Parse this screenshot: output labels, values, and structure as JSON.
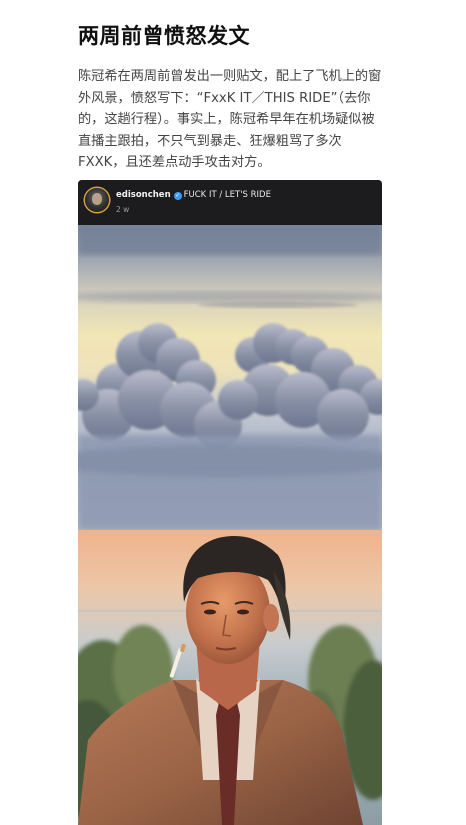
{
  "article": {
    "headline": "两周前曾愤怒发文",
    "body": "陈冠希在两周前曾发出一则贴文，配上了飞机上的窗外风景，愤怒写下：“FxxK IT／THIS RIDE”（去你的，这趟行程）。事实上，陈冠希早年在机场疑似被直播主跟拍，不只气到暴走、狂爆粗骂了多次FXXK，且还差点动手攻击对方。"
  },
  "post": {
    "username": "edisonchen",
    "verified_mark": "✓",
    "caption": "FUCK IT / LET'S RIDE",
    "time_ago": "2 w"
  },
  "colors": {
    "page_bg": "#ffffff",
    "headline": "#111111",
    "body_text": "#444444",
    "post_header_bg": "#1c1c1e",
    "verified_badge": "#3b9cf6",
    "avatar_ring": "#d8a23a"
  },
  "icons": {
    "verified": "verified-badge-icon"
  }
}
